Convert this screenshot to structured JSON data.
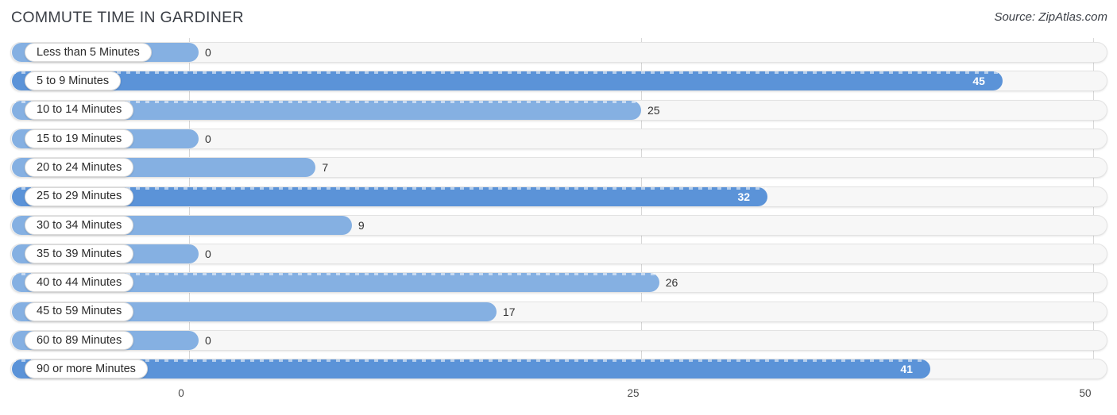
{
  "header": {
    "title": "COMMUTE TIME IN GARDINER",
    "source": "Source: ZipAtlas.com"
  },
  "axis": {
    "ticks": [
      "0",
      "25",
      "50"
    ],
    "min": 0,
    "max": 50
  },
  "chart_data": {
    "type": "bar",
    "orientation": "horizontal",
    "title": "COMMUTE TIME IN GARDINER",
    "xlabel": "",
    "ylabel": "",
    "xlim": [
      0,
      50
    ],
    "grid": true,
    "legend": "none",
    "categories": [
      "Less than 5 Minutes",
      "5 to 9 Minutes",
      "10 to 14 Minutes",
      "15 to 19 Minutes",
      "20 to 24 Minutes",
      "25 to 29 Minutes",
      "30 to 34 Minutes",
      "35 to 39 Minutes",
      "40 to 44 Minutes",
      "45 to 59 Minutes",
      "60 to 89 Minutes",
      "90 or more Minutes"
    ],
    "values": [
      0,
      45,
      25,
      0,
      7,
      32,
      9,
      0,
      26,
      17,
      0,
      41
    ],
    "value_labels": [
      "0",
      "45",
      "25",
      "0",
      "7",
      "32",
      "9",
      "0",
      "26",
      "17",
      "0",
      "41"
    ]
  },
  "rows": [
    {
      "label": "Less than 5 Minutes",
      "value": 0,
      "value_label": "0",
      "shade": "light",
      "label_inside": false
    },
    {
      "label": "5 to 9 Minutes",
      "value": 45,
      "value_label": "45",
      "shade": "dark",
      "label_inside": true
    },
    {
      "label": "10 to 14 Minutes",
      "value": 25,
      "value_label": "25",
      "shade": "light",
      "label_inside": false
    },
    {
      "label": "15 to 19 Minutes",
      "value": 0,
      "value_label": "0",
      "shade": "light",
      "label_inside": false
    },
    {
      "label": "20 to 24 Minutes",
      "value": 7,
      "value_label": "7",
      "shade": "light",
      "label_inside": false
    },
    {
      "label": "25 to 29 Minutes",
      "value": 32,
      "value_label": "32",
      "shade": "dark",
      "label_inside": true
    },
    {
      "label": "30 to 34 Minutes",
      "value": 9,
      "value_label": "9",
      "shade": "light",
      "label_inside": false
    },
    {
      "label": "35 to 39 Minutes",
      "value": 0,
      "value_label": "0",
      "shade": "light",
      "label_inside": false
    },
    {
      "label": "40 to 44 Minutes",
      "value": 26,
      "value_label": "26",
      "shade": "light",
      "label_inside": false
    },
    {
      "label": "45 to 59 Minutes",
      "value": 17,
      "value_label": "17",
      "shade": "light",
      "label_inside": false
    },
    {
      "label": "60 to 89 Minutes",
      "value": 0,
      "value_label": "0",
      "shade": "light",
      "label_inside": false
    },
    {
      "label": "90 or more Minutes",
      "value": 41,
      "value_label": "41",
      "shade": "dark",
      "label_inside": true
    }
  ],
  "colors": {
    "bar_light": "#85b0e2",
    "bar_dark": "#5b93d8",
    "track": "#f7f7f7",
    "gridline": "#d8d8d8",
    "text": "#3b3f46"
  }
}
